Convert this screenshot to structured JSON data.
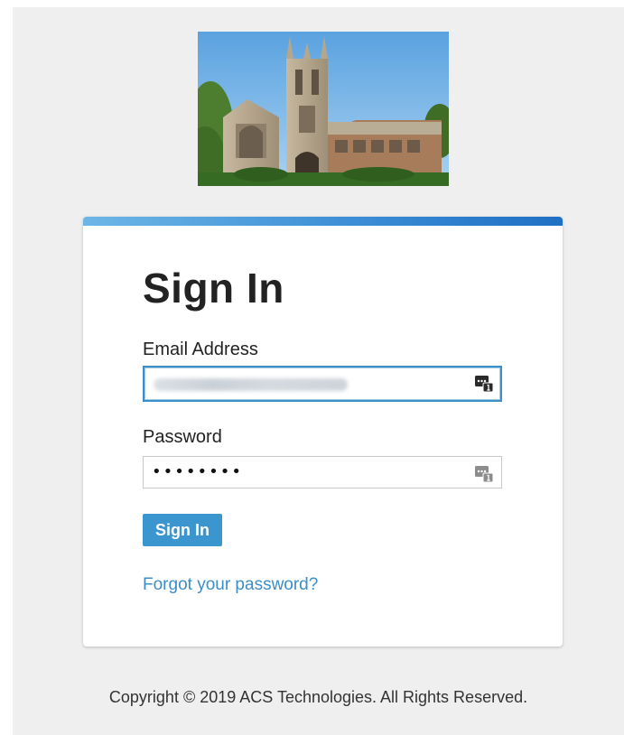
{
  "login": {
    "title": "Sign In",
    "email_label": "Email Address",
    "password_label": "Password",
    "password_mask": "••••••••",
    "submit_label": "Sign In",
    "forgot_link": "Forgot your password?"
  },
  "footer": {
    "copyright": "Copyright © 2019 ACS Technologies. All Rights Reserved."
  },
  "theme": {
    "accent": "#3b96cf",
    "link": "#3b8fc6",
    "focus_border": "#3e8ec9",
    "page_bg": "#efefef"
  },
  "icons": {
    "field_badge": "password-manager-icon",
    "hero": "church-building-photo"
  }
}
